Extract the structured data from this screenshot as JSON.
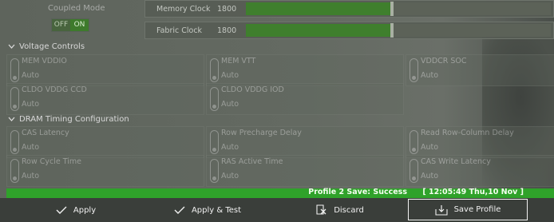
{
  "coupled_mode": {
    "label": "Coupled Mode",
    "off_label": "OFF",
    "on_label": "ON",
    "state": "ON"
  },
  "clocks": [
    {
      "label": "Memory Clock",
      "value": "1800",
      "fill_fraction": 0.48
    },
    {
      "label": "Fabric Clock",
      "value": "1800",
      "fill_fraction": 0.48
    }
  ],
  "voltage": {
    "title": "Voltage Controls",
    "fields": [
      {
        "label": "MEM VDDIO",
        "value": "Auto"
      },
      {
        "label": "MEM VTT",
        "value": "Auto"
      },
      {
        "label": "VDDCR SOC",
        "value": "Auto"
      },
      {
        "label": "CLDO VDDG CCD",
        "value": "Auto"
      },
      {
        "label": "CLDO VDDG IOD",
        "value": "Auto"
      }
    ]
  },
  "dram": {
    "title": "DRAM Timing Configuration",
    "fields": [
      {
        "label": "CAS Latency",
        "value": "Auto"
      },
      {
        "label": "Row Precharge Delay",
        "value": "Auto"
      },
      {
        "label": "Read Row-Column Delay",
        "value": "Auto"
      },
      {
        "label": "Row Cycle Time",
        "value": "Auto"
      },
      {
        "label": "RAS Active Time",
        "value": "Auto"
      },
      {
        "label": "CAS Write Latency",
        "value": "Auto"
      }
    ]
  },
  "status": {
    "message": "Profile 2 Save: Success",
    "timestamp": "[ 12:05:49 Thu,10 Nov ]",
    "color": "#2fa22a"
  },
  "buttons": {
    "apply": "Apply",
    "apply_test": "Apply & Test",
    "discard": "Discard",
    "save_profile": "Save Profile"
  }
}
